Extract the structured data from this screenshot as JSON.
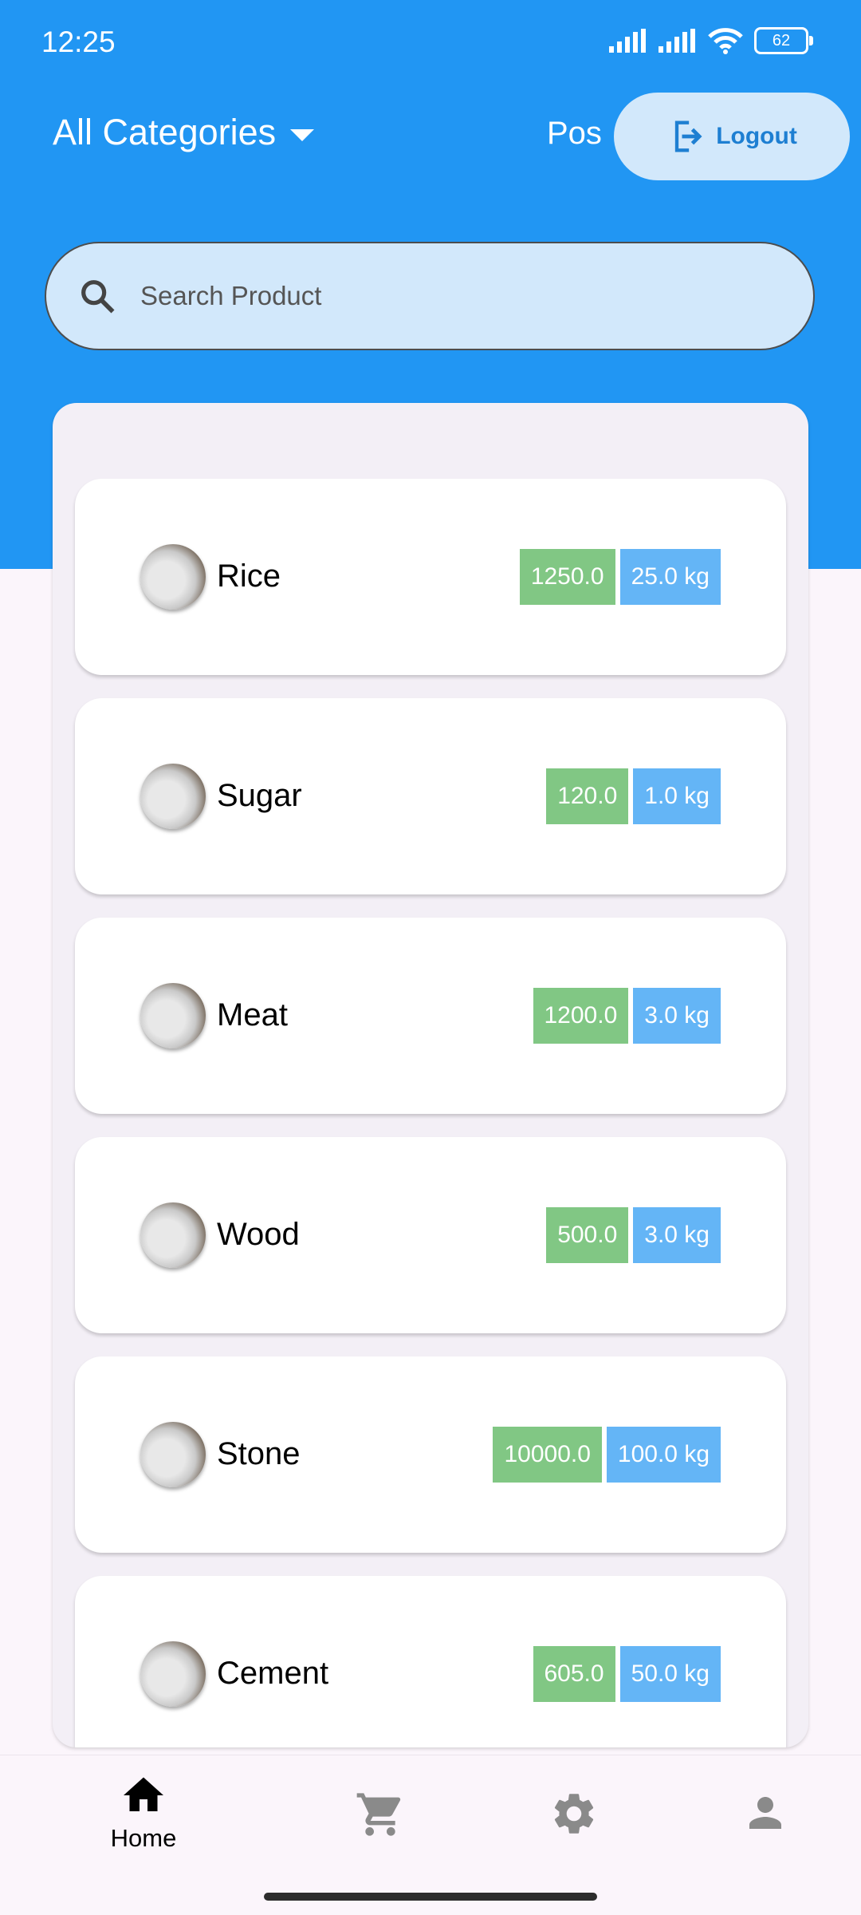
{
  "status_bar": {
    "time": "12:25",
    "battery": "62"
  },
  "header": {
    "category_label": "All Categories",
    "pos_label": "Pos",
    "logout_label": "Logout"
  },
  "search": {
    "placeholder": "Search Product"
  },
  "products": [
    {
      "name": "Rice",
      "price": "1250.0",
      "quantity": "25.0 kg"
    },
    {
      "name": "Sugar",
      "price": "120.0",
      "quantity": "1.0 kg"
    },
    {
      "name": "Meat",
      "price": "1200.0",
      "quantity": "3.0 kg"
    },
    {
      "name": "Wood",
      "price": "500.0",
      "quantity": "3.0 kg"
    },
    {
      "name": "Stone",
      "price": "10000.0",
      "quantity": "100.0 kg"
    },
    {
      "name": "Cement",
      "price": "605.0",
      "quantity": "50.0 kg"
    }
  ],
  "bottom_nav": {
    "items": [
      {
        "label": "Home",
        "icon": "home-icon",
        "active": true
      },
      {
        "label": "",
        "icon": "cart-icon",
        "active": false
      },
      {
        "label": "",
        "icon": "settings-icon",
        "active": false
      },
      {
        "label": "",
        "icon": "profile-icon",
        "active": false
      }
    ]
  },
  "colors": {
    "primary": "#2196f3",
    "search_bg": "#d2e8fb",
    "price_badge": "#81c784",
    "qty_badge": "#64b5f6"
  }
}
